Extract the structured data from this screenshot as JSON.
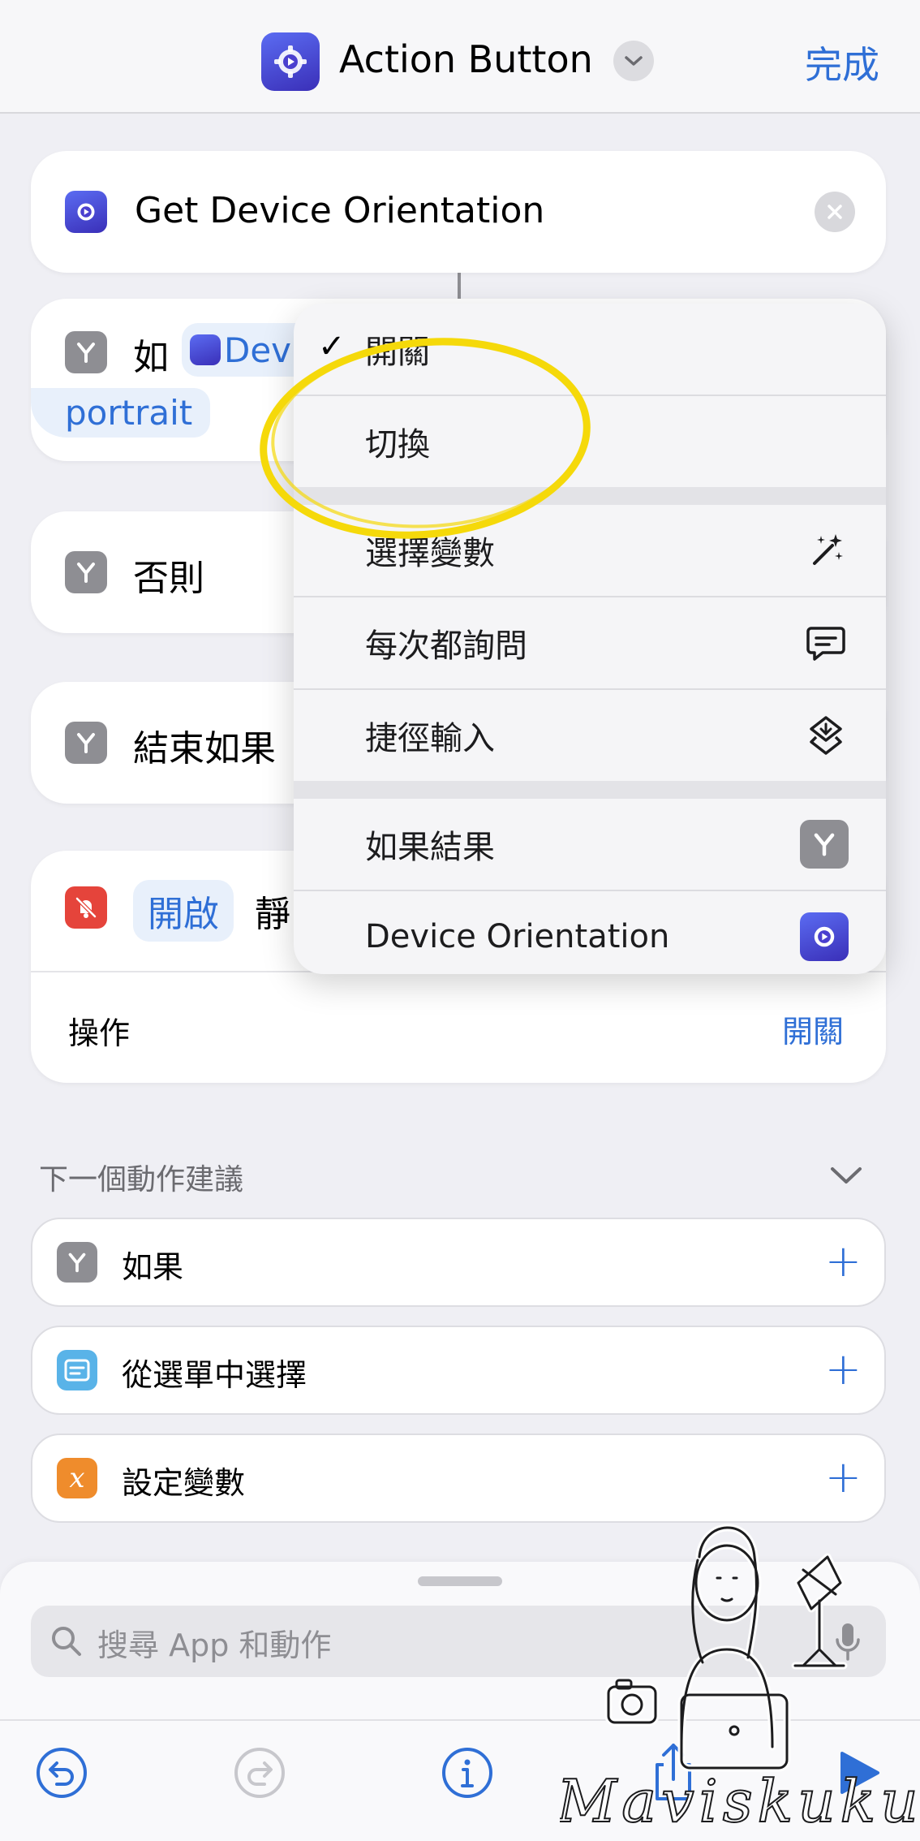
{
  "header": {
    "title": "Action Button",
    "done_label": "完成"
  },
  "action1": {
    "label": "Get Device Orientation"
  },
  "if_block": {
    "prefix": "如",
    "variable_label": "Dev",
    "value": "portrait"
  },
  "else_block": {
    "label": "否則"
  },
  "endif_block": {
    "label": "結束如果"
  },
  "silent_block": {
    "state_label": "開啟",
    "label_partial": "靜",
    "operation_label": "操作",
    "operation_value": "開關"
  },
  "menu": {
    "items": [
      {
        "label": "開關",
        "checked": true
      },
      {
        "label": "切換"
      },
      {
        "label": "選擇變數",
        "icon": "magic-wand-icon"
      },
      {
        "label": "每次都詢問",
        "icon": "speech-bubble-icon"
      },
      {
        "label": "捷徑輸入",
        "icon": "shortcuts-icon"
      },
      {
        "label": "如果結果",
        "icon": "if-icon"
      },
      {
        "label": "Device Orientation",
        "icon": "app-icon"
      }
    ],
    "check_mark": "✓"
  },
  "suggestions": {
    "heading": "下一個動作建議",
    "items": [
      {
        "label": "如果",
        "icon": "if-icon",
        "color": "#8e8e93"
      },
      {
        "label": "從選單中選擇",
        "icon": "menu-icon",
        "color": "#59b3e8"
      },
      {
        "label": "設定變數",
        "icon": "variable-icon",
        "color": "#ef8c2c"
      }
    ],
    "add_symbol": "+"
  },
  "search": {
    "placeholder": "搜尋 App 和動作"
  },
  "watermark": "Maviskuku",
  "colors": {
    "accent": "#2f6fd6",
    "highlight_circle": "#f5d90a"
  }
}
